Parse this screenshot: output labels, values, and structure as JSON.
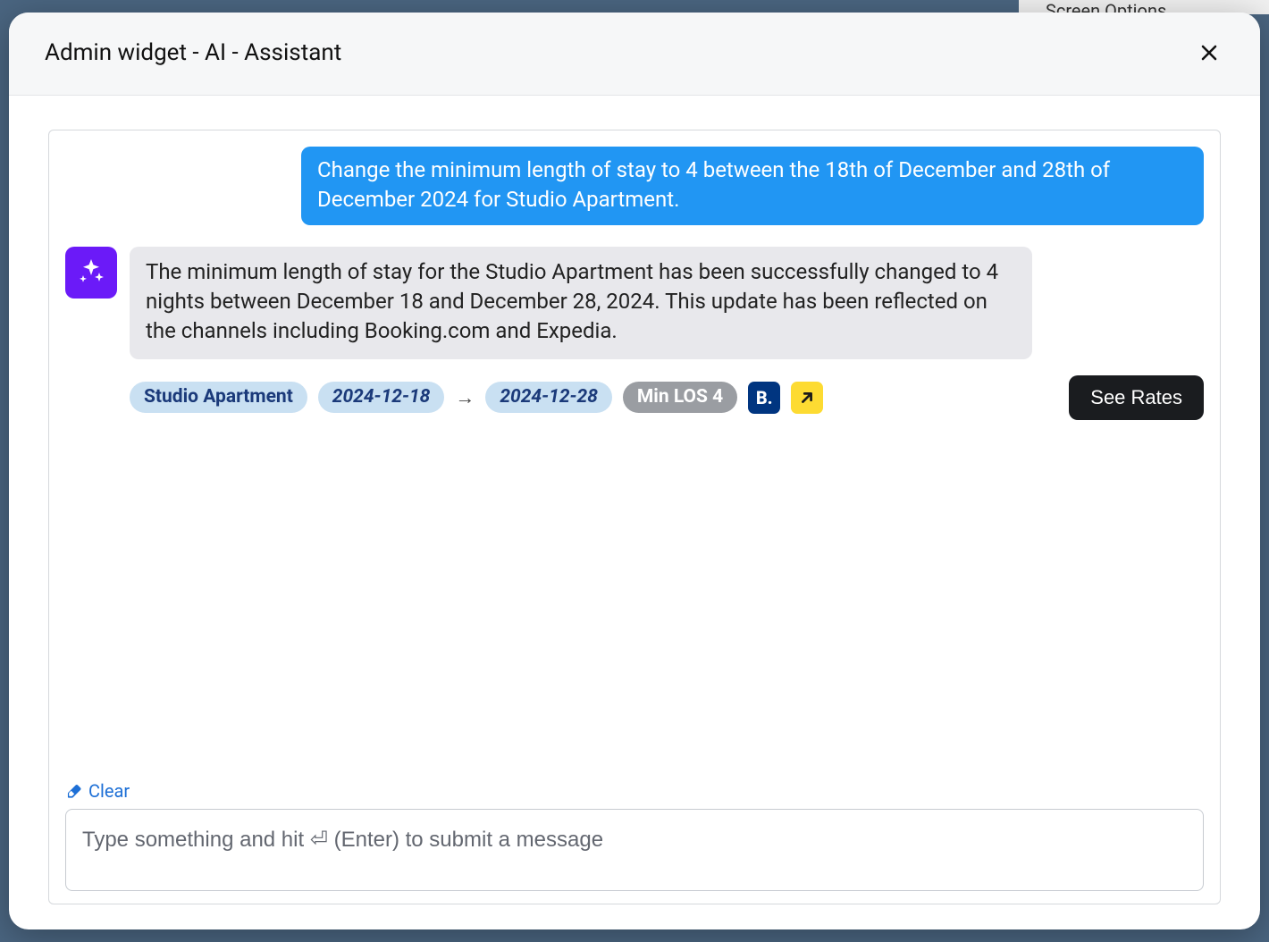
{
  "background": {
    "peek_text": "Screen Options"
  },
  "modal": {
    "title": "Admin widget - AI - Assistant"
  },
  "chat": {
    "user_message": "Change the minimum length of stay to 4 between the 18th of December and 28th of December 2024 for Studio Apartment.",
    "ai_message": "The minimum length of stay for the Studio Apartment has been successfully changed to 4 nights between December 18 and December 28, 2024. This update has been reflected on the channels including Booking.com and Expedia."
  },
  "tags": {
    "property": "Studio Apartment",
    "date_from": "2024-12-18",
    "date_to": "2024-12-28",
    "arrow": "→",
    "rule": "Min LOS 4",
    "channel_booking": "B.",
    "channel_expedia_icon": "expedia-icon",
    "see_rates": "See Rates"
  },
  "footer": {
    "clear": "Clear",
    "placeholder": "Type something and hit ⏎ (Enter) to submit a message"
  }
}
